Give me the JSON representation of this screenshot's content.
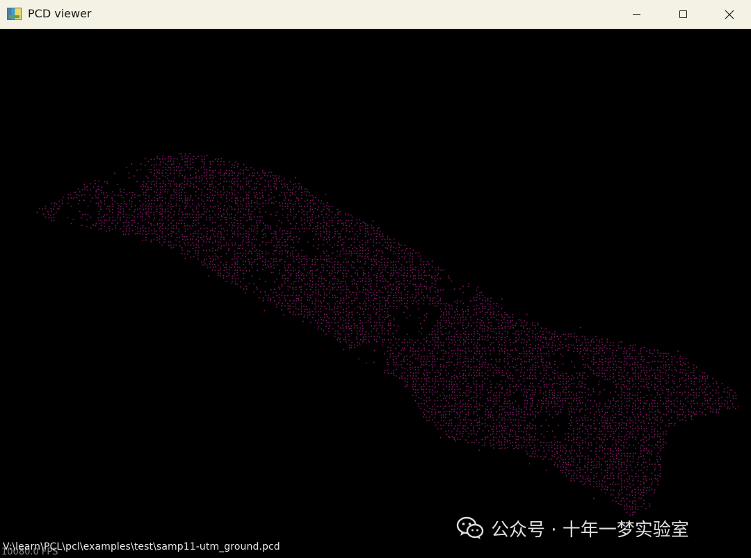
{
  "window": {
    "title": "PCD viewer",
    "controls": {
      "minimize": "minimize",
      "maximize": "maximize",
      "close": "close"
    }
  },
  "viewer": {
    "background_color": "#000000",
    "point_color": "#8b1a6b",
    "file_path": "V:\\learn\\PCL\\pcl\\examples\\test\\samp11-utm_ground.pcd",
    "fps_overlay": "10080.0 FPS"
  },
  "watermark": {
    "text": "公众号 · 十年一梦实验室",
    "logo_icon": "wechat-logo-icon"
  }
}
